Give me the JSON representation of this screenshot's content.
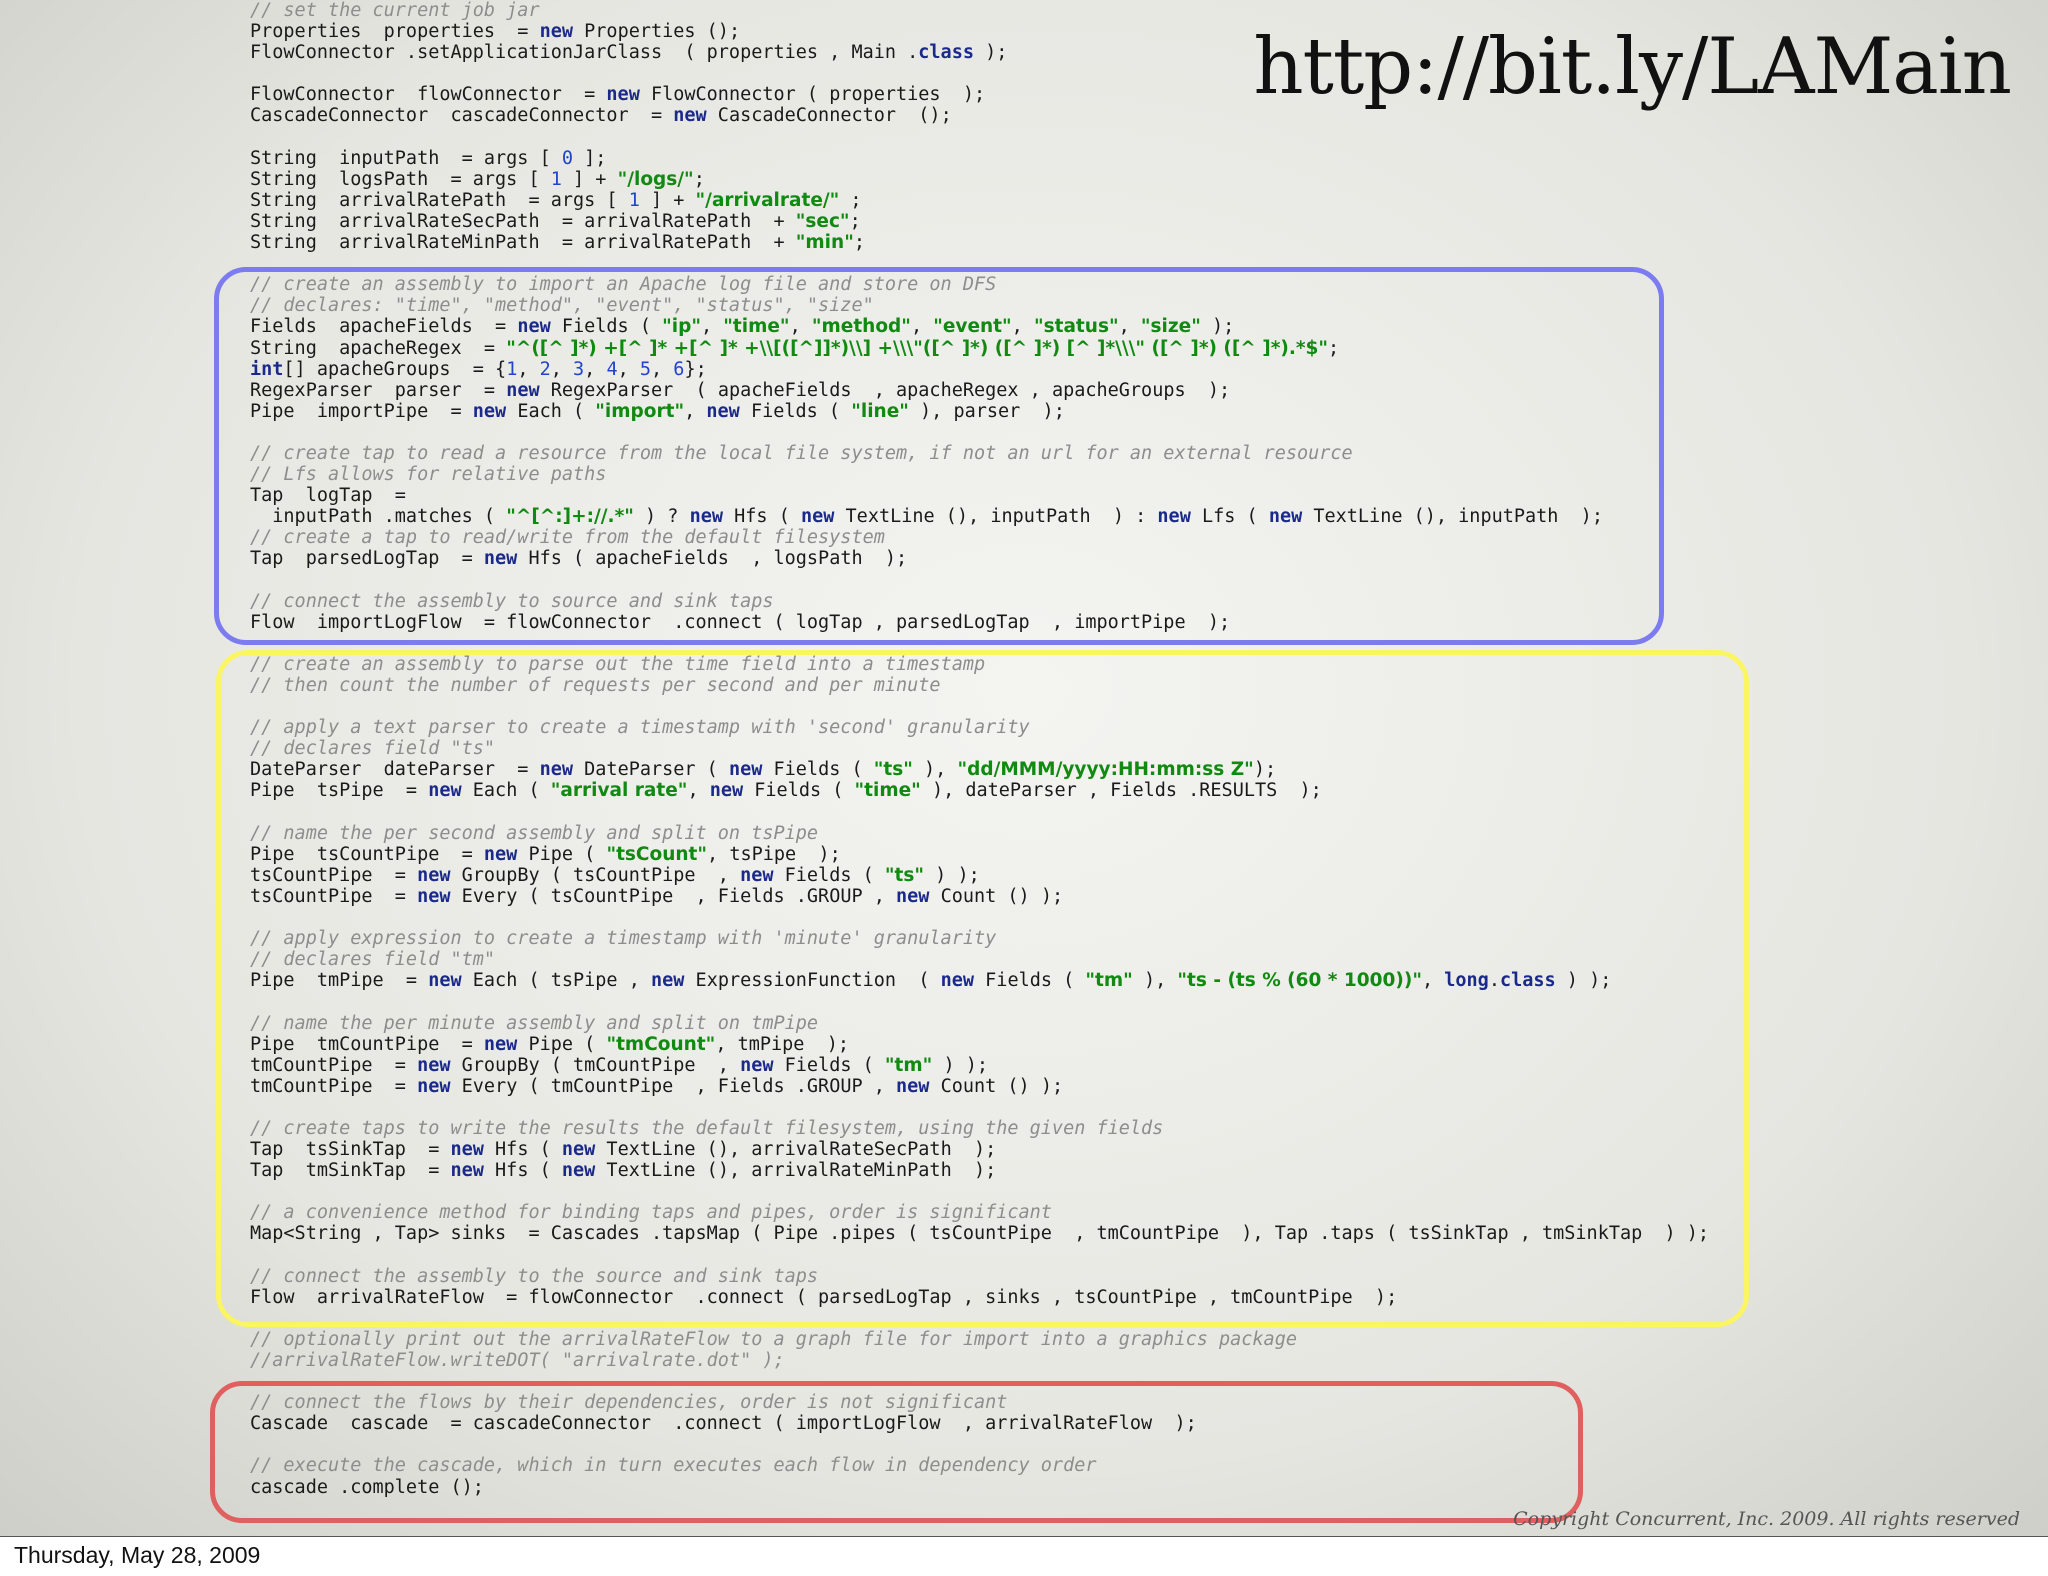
{
  "title_url": "http://bit.ly/LAMain",
  "copyright": "Copyright Concurrent, Inc. 2009. All rights reserved",
  "footer_date": "Thursday, May 28, 2009",
  "colors": {
    "box_import": "#7c7cf0",
    "box_arrival": "#fbf561",
    "box_cascade": "#e06060",
    "comment": "#8d8d8d",
    "keyword": "#1b2a8a",
    "string": "#118a11",
    "number": "#2244cc"
  },
  "code_lines": [
    [
      [
        "cm",
        "// set the current job jar"
      ]
    ],
    [
      [
        "",
        "Properties  properties  = "
      ],
      [
        "kw",
        "new"
      ],
      [
        "",
        " Properties ();"
      ]
    ],
    [
      [
        "",
        "FlowConnector .setApplicationJarClass  ( properties , Main ."
      ],
      [
        "kw",
        "class"
      ],
      [
        "",
        " );"
      ]
    ],
    [],
    [
      [
        "",
        "FlowConnector  flowConnector  = "
      ],
      [
        "kw",
        "new"
      ],
      [
        "",
        " FlowConnector ( properties  );"
      ]
    ],
    [
      [
        "",
        "CascadeConnector  cascadeConnector  = "
      ],
      [
        "kw",
        "new"
      ],
      [
        "",
        " CascadeConnector  ();"
      ]
    ],
    [],
    [
      [
        "",
        "String  inputPath  = args [ "
      ],
      [
        "nm",
        "0"
      ],
      [
        "",
        " ];"
      ]
    ],
    [
      [
        "",
        "String  logsPath  = args [ "
      ],
      [
        "nm",
        "1"
      ],
      [
        "",
        " ] + "
      ],
      [
        "st",
        "\"/logs/\""
      ],
      [
        "",
        ";"
      ]
    ],
    [
      [
        "",
        "String  arrivalRatePath  = args [ "
      ],
      [
        "nm",
        "1"
      ],
      [
        "",
        " ] + "
      ],
      [
        "st",
        "\"/arrivalrate/\""
      ],
      [
        "",
        " ;"
      ]
    ],
    [
      [
        "",
        "String  arrivalRateSecPath  = arrivalRatePath  + "
      ],
      [
        "st",
        "\"sec\""
      ],
      [
        "",
        ";"
      ]
    ],
    [
      [
        "",
        "String  arrivalRateMinPath  = arrivalRatePath  + "
      ],
      [
        "st",
        "\"min\""
      ],
      [
        "",
        ";"
      ]
    ],
    [],
    [
      [
        "cm",
        "// create an assembly to import an Apache log file and store on DFS"
      ]
    ],
    [
      [
        "cm",
        "// declares: \"time\", \"method\", \"event\", \"status\", \"size\""
      ]
    ],
    [
      [
        "",
        "Fields  apacheFields  = "
      ],
      [
        "kw",
        "new"
      ],
      [
        "",
        " Fields ( "
      ],
      [
        "st",
        "\"ip\""
      ],
      [
        "",
        ", "
      ],
      [
        "st",
        "\"time\""
      ],
      [
        "",
        ", "
      ],
      [
        "st",
        "\"method\""
      ],
      [
        "",
        ", "
      ],
      [
        "st",
        "\"event\""
      ],
      [
        "",
        ", "
      ],
      [
        "st",
        "\"status\""
      ],
      [
        "",
        ", "
      ],
      [
        "st",
        "\"size\""
      ],
      [
        "",
        " );"
      ]
    ],
    [
      [
        "",
        "String  apacheRegex  = "
      ],
      [
        "st",
        "\"^([^ ]*) +[^ ]* +[^ ]* +\\\\[([^]]*)\\\\] +\\\\\\\"([^ ]*) ([^ ]*) [^ ]*\\\\\\\" ([^ ]*) ([^ ]*).*$\""
      ],
      [
        "",
        ";"
      ]
    ],
    [
      [
        "kw",
        "int"
      ],
      [
        "",
        "[] apacheGroups  = {"
      ],
      [
        "nm",
        "1"
      ],
      [
        "",
        ", "
      ],
      [
        "nm",
        "2"
      ],
      [
        "",
        ", "
      ],
      [
        "nm",
        "3"
      ],
      [
        "",
        ", "
      ],
      [
        "nm",
        "4"
      ],
      [
        "",
        ", "
      ],
      [
        "nm",
        "5"
      ],
      [
        "",
        ", "
      ],
      [
        "nm",
        "6"
      ],
      [
        "",
        "};"
      ]
    ],
    [
      [
        "",
        "RegexParser  parser  = "
      ],
      [
        "kw",
        "new"
      ],
      [
        "",
        " RegexParser  ( apacheFields  , apacheRegex , apacheGroups  );"
      ]
    ],
    [
      [
        "",
        "Pipe  importPipe  = "
      ],
      [
        "kw",
        "new"
      ],
      [
        "",
        " Each ( "
      ],
      [
        "st",
        "\"import\""
      ],
      [
        "",
        ", "
      ],
      [
        "kw",
        "new"
      ],
      [
        "",
        " Fields ( "
      ],
      [
        "st",
        "\"line\""
      ],
      [
        "",
        " ), parser  );"
      ]
    ],
    [],
    [
      [
        "cm",
        "// create tap to read a resource from the local file system, if not an url for an external resource"
      ]
    ],
    [
      [
        "cm",
        "// Lfs allows for relative paths"
      ]
    ],
    [
      [
        "",
        "Tap  logTap  ="
      ]
    ],
    [
      [
        "",
        "  inputPath .matches ( "
      ],
      [
        "st",
        "\"^[^:]+://.*\""
      ],
      [
        "",
        " ) ? "
      ],
      [
        "kw",
        "new"
      ],
      [
        "",
        " Hfs ( "
      ],
      [
        "kw",
        "new"
      ],
      [
        "",
        " TextLine (), inputPath  ) : "
      ],
      [
        "kw",
        "new"
      ],
      [
        "",
        " Lfs ( "
      ],
      [
        "kw",
        "new"
      ],
      [
        "",
        " TextLine (), inputPath  );"
      ]
    ],
    [
      [
        "cm",
        "// create a tap to read/write from the default filesystem"
      ]
    ],
    [
      [
        "",
        "Tap  parsedLogTap  = "
      ],
      [
        "kw",
        "new"
      ],
      [
        "",
        " Hfs ( apacheFields  , logsPath  );"
      ]
    ],
    [],
    [
      [
        "cm",
        "// connect the assembly to source and sink taps"
      ]
    ],
    [
      [
        "",
        "Flow  importLogFlow  = flowConnector  .connect ( logTap , parsedLogTap  , importPipe  );"
      ]
    ],
    [],
    [
      [
        "cm",
        "// create an assembly to parse out the time field into a timestamp"
      ]
    ],
    [
      [
        "cm",
        "// then count the number of requests per second and per minute"
      ]
    ],
    [],
    [
      [
        "cm",
        "// apply a text parser to create a timestamp with 'second' granularity"
      ]
    ],
    [
      [
        "cm",
        "// declares field \"ts\""
      ]
    ],
    [
      [
        "",
        "DateParser  dateParser  = "
      ],
      [
        "kw",
        "new"
      ],
      [
        "",
        " DateParser ( "
      ],
      [
        "kw",
        "new"
      ],
      [
        "",
        " Fields ( "
      ],
      [
        "st",
        "\"ts\""
      ],
      [
        "",
        " ), "
      ],
      [
        "st",
        "\"dd/MMM/yyyy:HH:mm:ss Z\""
      ],
      [
        "",
        ");"
      ]
    ],
    [
      [
        "",
        "Pipe  tsPipe  = "
      ],
      [
        "kw",
        "new"
      ],
      [
        "",
        " Each ( "
      ],
      [
        "st",
        "\"arrival rate\""
      ],
      [
        "",
        ", "
      ],
      [
        "kw",
        "new"
      ],
      [
        "",
        " Fields ( "
      ],
      [
        "st",
        "\"time\""
      ],
      [
        "",
        " ), dateParser , Fields .RESULTS  );"
      ]
    ],
    [],
    [
      [
        "cm",
        "// name the per second assembly and split on tsPipe"
      ]
    ],
    [
      [
        "",
        "Pipe  tsCountPipe  = "
      ],
      [
        "kw",
        "new"
      ],
      [
        "",
        " Pipe ( "
      ],
      [
        "st",
        "\"tsCount\""
      ],
      [
        "",
        ", tsPipe  );"
      ]
    ],
    [
      [
        "",
        "tsCountPipe  = "
      ],
      [
        "kw",
        "new"
      ],
      [
        "",
        " GroupBy ( tsCountPipe  , "
      ],
      [
        "kw",
        "new"
      ],
      [
        "",
        " Fields ( "
      ],
      [
        "st",
        "\"ts\""
      ],
      [
        "",
        " ) );"
      ]
    ],
    [
      [
        "",
        "tsCountPipe  = "
      ],
      [
        "kw",
        "new"
      ],
      [
        "",
        " Every ( tsCountPipe  , Fields .GROUP , "
      ],
      [
        "kw",
        "new"
      ],
      [
        "",
        " Count () );"
      ]
    ],
    [],
    [
      [
        "cm",
        "// apply expression to create a timestamp with 'minute' granularity"
      ]
    ],
    [
      [
        "cm",
        "// declares field \"tm\""
      ]
    ],
    [
      [
        "",
        "Pipe  tmPipe  = "
      ],
      [
        "kw",
        "new"
      ],
      [
        "",
        " Each ( tsPipe , "
      ],
      [
        "kw",
        "new"
      ],
      [
        "",
        " ExpressionFunction  ( "
      ],
      [
        "kw",
        "new"
      ],
      [
        "",
        " Fields ( "
      ],
      [
        "st",
        "\"tm\""
      ],
      [
        "",
        " ), "
      ],
      [
        "st",
        "\"ts - (ts % (60 * 1000))\""
      ],
      [
        "",
        ", "
      ],
      [
        "kw",
        "long"
      ],
      [
        "",
        "."
      ],
      [
        "kw",
        "class"
      ],
      [
        "",
        " ) );"
      ]
    ],
    [],
    [
      [
        "cm",
        "// name the per minute assembly and split on tmPipe"
      ]
    ],
    [
      [
        "",
        "Pipe  tmCountPipe  = "
      ],
      [
        "kw",
        "new"
      ],
      [
        "",
        " Pipe ( "
      ],
      [
        "st",
        "\"tmCount\""
      ],
      [
        "",
        ", tmPipe  );"
      ]
    ],
    [
      [
        "",
        "tmCountPipe  = "
      ],
      [
        "kw",
        "new"
      ],
      [
        "",
        " GroupBy ( tmCountPipe  , "
      ],
      [
        "kw",
        "new"
      ],
      [
        "",
        " Fields ( "
      ],
      [
        "st",
        "\"tm\""
      ],
      [
        "",
        " ) );"
      ]
    ],
    [
      [
        "",
        "tmCountPipe  = "
      ],
      [
        "kw",
        "new"
      ],
      [
        "",
        " Every ( tmCountPipe  , Fields .GROUP , "
      ],
      [
        "kw",
        "new"
      ],
      [
        "",
        " Count () );"
      ]
    ],
    [],
    [
      [
        "cm",
        "// create taps to write the results the default filesystem, using the given fields"
      ]
    ],
    [
      [
        "",
        "Tap  tsSinkTap  = "
      ],
      [
        "kw",
        "new"
      ],
      [
        "",
        " Hfs ( "
      ],
      [
        "kw",
        "new"
      ],
      [
        "",
        " TextLine (), arrivalRateSecPath  );"
      ]
    ],
    [
      [
        "",
        "Tap  tmSinkTap  = "
      ],
      [
        "kw",
        "new"
      ],
      [
        "",
        " Hfs ( "
      ],
      [
        "kw",
        "new"
      ],
      [
        "",
        " TextLine (), arrivalRateMinPath  );"
      ]
    ],
    [],
    [
      [
        "cm",
        "// a convenience method for binding taps and pipes, order is significant"
      ]
    ],
    [
      [
        "",
        "Map<String , Tap> sinks  = Cascades .tapsMap ( Pipe .pipes ( tsCountPipe  , tmCountPipe  ), Tap .taps ( tsSinkTap , tmSinkTap  ) );"
      ]
    ],
    [],
    [
      [
        "cm",
        "// connect the assembly to the source and sink taps"
      ]
    ],
    [
      [
        "",
        "Flow  arrivalRateFlow  = flowConnector  .connect ( parsedLogTap , sinks , tsCountPipe , tmCountPipe  );"
      ]
    ],
    [],
    [
      [
        "cm",
        "// optionally print out the arrivalRateFlow to a graph file for import into a graphics package"
      ]
    ],
    [
      [
        "cm",
        "//arrivalRateFlow.writeDOT( \"arrivalrate.dot\" );"
      ]
    ],
    [],
    [
      [
        "cm",
        "// connect the flows by their dependencies, order is not significant"
      ]
    ],
    [
      [
        "",
        "Cascade  cascade  = cascadeConnector  .connect ( importLogFlow  , arrivalRateFlow  );"
      ]
    ],
    [],
    [
      [
        "cm",
        "// execute the cascade, which in turn executes each flow in dependency order"
      ]
    ],
    [
      [
        "",
        "cascade .complete ();"
      ]
    ]
  ]
}
